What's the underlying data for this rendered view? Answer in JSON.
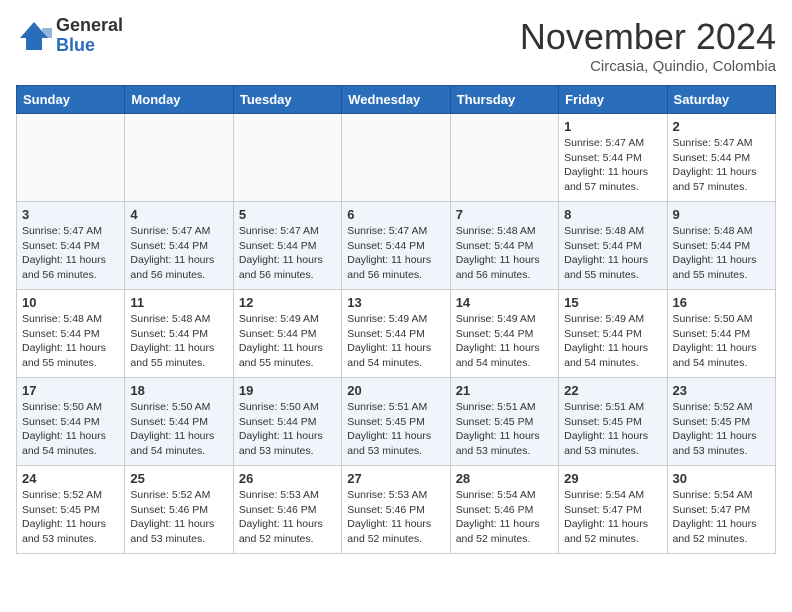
{
  "header": {
    "logo_general": "General",
    "logo_blue": "Blue",
    "month_title": "November 2024",
    "location": "Circasia, Quindio, Colombia"
  },
  "days_of_week": [
    "Sunday",
    "Monday",
    "Tuesday",
    "Wednesday",
    "Thursday",
    "Friday",
    "Saturday"
  ],
  "weeks": [
    [
      {
        "day": "",
        "info": "",
        "empty": true
      },
      {
        "day": "",
        "info": "",
        "empty": true
      },
      {
        "day": "",
        "info": "",
        "empty": true
      },
      {
        "day": "",
        "info": "",
        "empty": true
      },
      {
        "day": "",
        "info": "",
        "empty": true
      },
      {
        "day": "1",
        "info": "Sunrise: 5:47 AM\nSunset: 5:44 PM\nDaylight: 11 hours\nand 57 minutes.",
        "empty": false
      },
      {
        "day": "2",
        "info": "Sunrise: 5:47 AM\nSunset: 5:44 PM\nDaylight: 11 hours\nand 57 minutes.",
        "empty": false
      }
    ],
    [
      {
        "day": "3",
        "info": "Sunrise: 5:47 AM\nSunset: 5:44 PM\nDaylight: 11 hours\nand 56 minutes.",
        "empty": false
      },
      {
        "day": "4",
        "info": "Sunrise: 5:47 AM\nSunset: 5:44 PM\nDaylight: 11 hours\nand 56 minutes.",
        "empty": false
      },
      {
        "day": "5",
        "info": "Sunrise: 5:47 AM\nSunset: 5:44 PM\nDaylight: 11 hours\nand 56 minutes.",
        "empty": false
      },
      {
        "day": "6",
        "info": "Sunrise: 5:47 AM\nSunset: 5:44 PM\nDaylight: 11 hours\nand 56 minutes.",
        "empty": false
      },
      {
        "day": "7",
        "info": "Sunrise: 5:48 AM\nSunset: 5:44 PM\nDaylight: 11 hours\nand 56 minutes.",
        "empty": false
      },
      {
        "day": "8",
        "info": "Sunrise: 5:48 AM\nSunset: 5:44 PM\nDaylight: 11 hours\nand 55 minutes.",
        "empty": false
      },
      {
        "day": "9",
        "info": "Sunrise: 5:48 AM\nSunset: 5:44 PM\nDaylight: 11 hours\nand 55 minutes.",
        "empty": false
      }
    ],
    [
      {
        "day": "10",
        "info": "Sunrise: 5:48 AM\nSunset: 5:44 PM\nDaylight: 11 hours\nand 55 minutes.",
        "empty": false
      },
      {
        "day": "11",
        "info": "Sunrise: 5:48 AM\nSunset: 5:44 PM\nDaylight: 11 hours\nand 55 minutes.",
        "empty": false
      },
      {
        "day": "12",
        "info": "Sunrise: 5:49 AM\nSunset: 5:44 PM\nDaylight: 11 hours\nand 55 minutes.",
        "empty": false
      },
      {
        "day": "13",
        "info": "Sunrise: 5:49 AM\nSunset: 5:44 PM\nDaylight: 11 hours\nand 54 minutes.",
        "empty": false
      },
      {
        "day": "14",
        "info": "Sunrise: 5:49 AM\nSunset: 5:44 PM\nDaylight: 11 hours\nand 54 minutes.",
        "empty": false
      },
      {
        "day": "15",
        "info": "Sunrise: 5:49 AM\nSunset: 5:44 PM\nDaylight: 11 hours\nand 54 minutes.",
        "empty": false
      },
      {
        "day": "16",
        "info": "Sunrise: 5:50 AM\nSunset: 5:44 PM\nDaylight: 11 hours\nand 54 minutes.",
        "empty": false
      }
    ],
    [
      {
        "day": "17",
        "info": "Sunrise: 5:50 AM\nSunset: 5:44 PM\nDaylight: 11 hours\nand 54 minutes.",
        "empty": false
      },
      {
        "day": "18",
        "info": "Sunrise: 5:50 AM\nSunset: 5:44 PM\nDaylight: 11 hours\nand 54 minutes.",
        "empty": false
      },
      {
        "day": "19",
        "info": "Sunrise: 5:50 AM\nSunset: 5:44 PM\nDaylight: 11 hours\nand 53 minutes.",
        "empty": false
      },
      {
        "day": "20",
        "info": "Sunrise: 5:51 AM\nSunset: 5:45 PM\nDaylight: 11 hours\nand 53 minutes.",
        "empty": false
      },
      {
        "day": "21",
        "info": "Sunrise: 5:51 AM\nSunset: 5:45 PM\nDaylight: 11 hours\nand 53 minutes.",
        "empty": false
      },
      {
        "day": "22",
        "info": "Sunrise: 5:51 AM\nSunset: 5:45 PM\nDaylight: 11 hours\nand 53 minutes.",
        "empty": false
      },
      {
        "day": "23",
        "info": "Sunrise: 5:52 AM\nSunset: 5:45 PM\nDaylight: 11 hours\nand 53 minutes.",
        "empty": false
      }
    ],
    [
      {
        "day": "24",
        "info": "Sunrise: 5:52 AM\nSunset: 5:45 PM\nDaylight: 11 hours\nand 53 minutes.",
        "empty": false
      },
      {
        "day": "25",
        "info": "Sunrise: 5:52 AM\nSunset: 5:46 PM\nDaylight: 11 hours\nand 53 minutes.",
        "empty": false
      },
      {
        "day": "26",
        "info": "Sunrise: 5:53 AM\nSunset: 5:46 PM\nDaylight: 11 hours\nand 52 minutes.",
        "empty": false
      },
      {
        "day": "27",
        "info": "Sunrise: 5:53 AM\nSunset: 5:46 PM\nDaylight: 11 hours\nand 52 minutes.",
        "empty": false
      },
      {
        "day": "28",
        "info": "Sunrise: 5:54 AM\nSunset: 5:46 PM\nDaylight: 11 hours\nand 52 minutes.",
        "empty": false
      },
      {
        "day": "29",
        "info": "Sunrise: 5:54 AM\nSunset: 5:47 PM\nDaylight: 11 hours\nand 52 minutes.",
        "empty": false
      },
      {
        "day": "30",
        "info": "Sunrise: 5:54 AM\nSunset: 5:47 PM\nDaylight: 11 hours\nand 52 minutes.",
        "empty": false
      }
    ]
  ]
}
